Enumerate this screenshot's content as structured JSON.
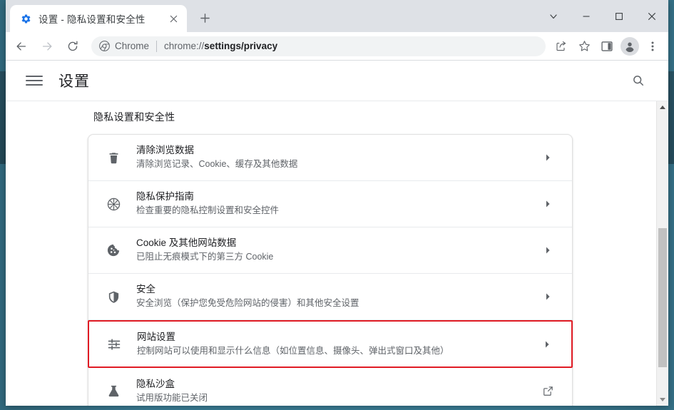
{
  "window": {
    "tab": {
      "title": "设置 - 隐私设置和安全性",
      "favicon": "gear-icon",
      "close_label": "✕"
    },
    "new_tab_label": "+",
    "controls": {
      "tab_search_label": "⌄",
      "minimize_label": "—",
      "maximize_label": "☐",
      "close_label": "✕"
    }
  },
  "toolbar": {
    "back_label": "←",
    "forward_label": "→",
    "reload_label": "⟳",
    "omnibox": {
      "scheme_label": "Chrome",
      "url_prefix": "chrome://",
      "url_bold": "settings/privacy",
      "full_url": "chrome://settings/privacy"
    },
    "share_icon": "share-icon",
    "bookmark_icon": "star-icon",
    "sidepanel_icon": "side-panel-icon",
    "profile_icon": "avatar-icon",
    "menu_icon": "three-dot-menu-icon"
  },
  "settings": {
    "menu_label": "菜单",
    "title": "设置",
    "search_label": "搜索设置",
    "section_heading": "隐私设置和安全性",
    "rows": [
      {
        "icon": "trash-icon",
        "title": "清除浏览数据",
        "subtitle": "清除浏览记录、Cookie、缓存及其他数据",
        "action": "chevron-right-icon",
        "highlighted": false
      },
      {
        "icon": "privacy-guide-icon",
        "title": "隐私保护指南",
        "subtitle": "检查重要的隐私控制设置和安全控件",
        "action": "chevron-right-icon",
        "highlighted": false
      },
      {
        "icon": "cookie-icon",
        "title": "Cookie 及其他网站数据",
        "subtitle": "已阻止无痕模式下的第三方 Cookie",
        "action": "chevron-right-icon",
        "highlighted": false
      },
      {
        "icon": "shield-icon",
        "title": "安全",
        "subtitle": "安全浏览（保护您免受危险网站的侵害）和其他安全设置",
        "action": "chevron-right-icon",
        "highlighted": false
      },
      {
        "icon": "tune-icon",
        "title": "网站设置",
        "subtitle": "控制网站可以使用和显示什么信息（如位置信息、摄像头、弹出式窗口及其他）",
        "action": "chevron-right-icon",
        "highlighted": true
      },
      {
        "icon": "flask-icon",
        "title": "隐私沙盒",
        "subtitle": "试用版功能已关闭",
        "action": "external-link-icon",
        "highlighted": false
      }
    ]
  },
  "colors": {
    "highlight_border": "#e01b24",
    "tab_strip_bg": "#dee1e6",
    "text_primary": "#202124",
    "text_secondary": "#5f6368",
    "desktop_bg": "#3c8099"
  },
  "scrollbar": {
    "up_label": "▲",
    "down_label": "▼"
  }
}
